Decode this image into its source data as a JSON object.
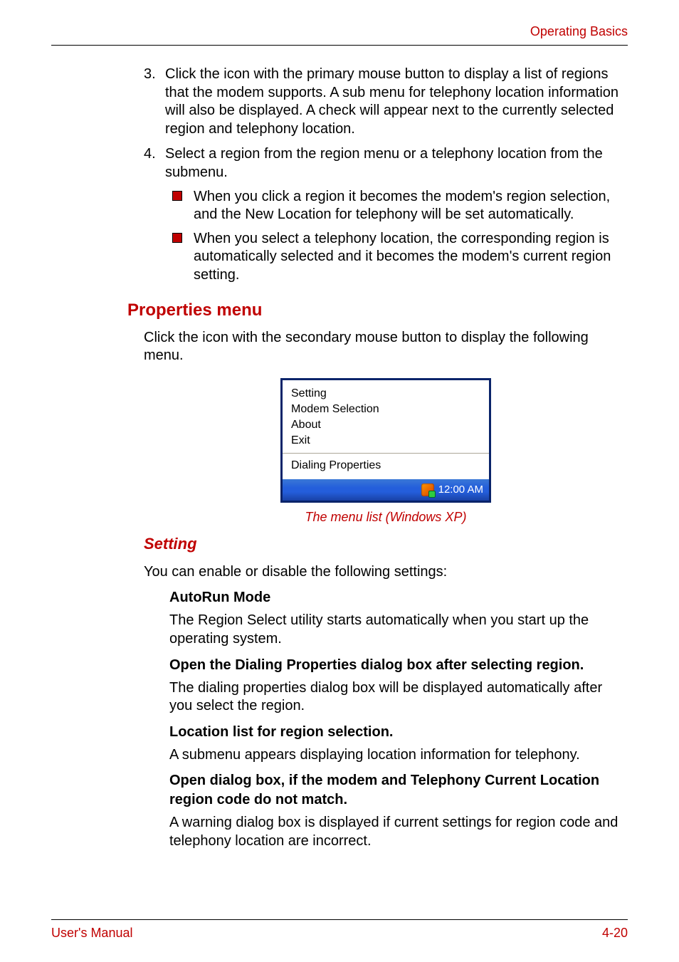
{
  "header": {
    "breadcrumb": "Operating Basics"
  },
  "list": {
    "item3": {
      "num": "3.",
      "text": "Click the icon with the primary mouse button to display a list of regions that the modem supports. A sub menu for telephony location information will also be displayed. A check will appear next to the currently selected region and telephony location."
    },
    "item4": {
      "num": "4.",
      "text": "Select a region from the region menu or a telephony location from the submenu.",
      "bullets": [
        "When you click a region it becomes the modem's region selection, and the New Location for telephony will be set automatically.",
        "When you select a telephony location, the corresponding region is automatically selected and it becomes the modem's current region setting."
      ]
    }
  },
  "sections": {
    "properties_menu": {
      "title": "Properties menu",
      "intro": "Click the icon with the secondary mouse button to display the following menu."
    },
    "setting": {
      "title": "Setting",
      "intro": "You can enable or disable the following settings:",
      "items": [
        {
          "title": "AutoRun Mode",
          "text": "The Region Select utility starts automatically when you start up the operating system."
        },
        {
          "title": "Open the Dialing Properties dialog box after selecting region.",
          "text": "The dialing properties dialog box will be displayed automatically after you select the region."
        },
        {
          "title": "Location list for region selection.",
          "text": "A submenu appears displaying location information for telephony."
        },
        {
          "title": "Open dialog box, if the modem and Telephony Current Location region code do not match.",
          "text": "A warning dialog box is displayed if current settings for region code and telephony location are incorrect."
        }
      ]
    }
  },
  "figure": {
    "menu": {
      "group1": [
        "Setting",
        "Modem Selection",
        "About",
        "Exit"
      ],
      "group2": [
        "Dialing Properties"
      ],
      "clock": "12:00 AM"
    },
    "caption": "The menu list (Windows XP)"
  },
  "footer": {
    "left": "User's Manual",
    "right": "4-20"
  }
}
